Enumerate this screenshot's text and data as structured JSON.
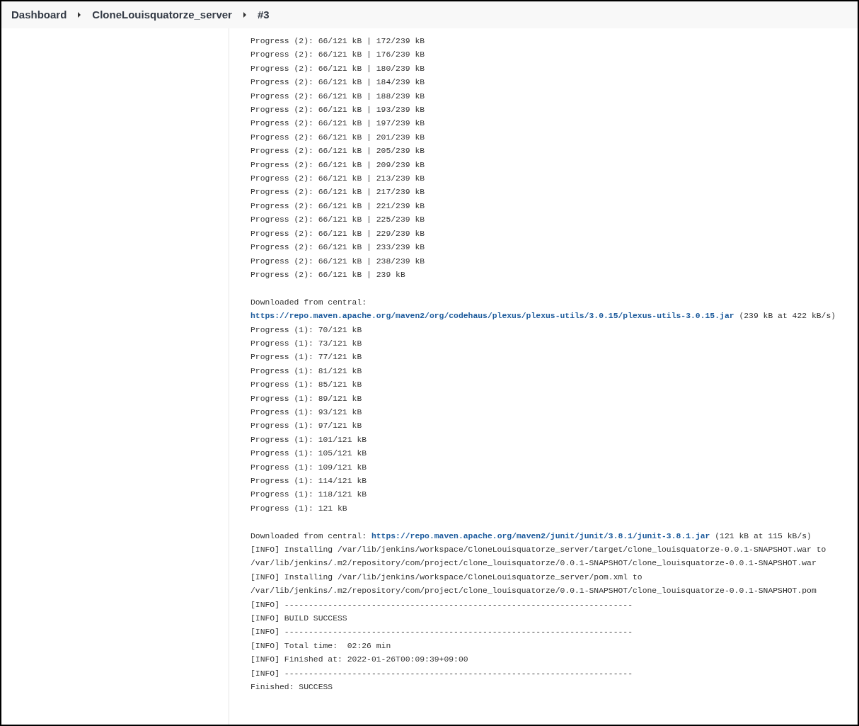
{
  "breadcrumbs": [
    {
      "label": "Dashboard"
    },
    {
      "label": "CloneLouisquatorze_server"
    },
    {
      "label": "#3"
    }
  ],
  "console": {
    "lines": [
      {
        "kind": "text",
        "text": "Progress (2): 66/121 kB | 172/239 kB"
      },
      {
        "kind": "text",
        "text": "Progress (2): 66/121 kB | 176/239 kB"
      },
      {
        "kind": "text",
        "text": "Progress (2): 66/121 kB | 180/239 kB"
      },
      {
        "kind": "text",
        "text": "Progress (2): 66/121 kB | 184/239 kB"
      },
      {
        "kind": "text",
        "text": "Progress (2): 66/121 kB | 188/239 kB"
      },
      {
        "kind": "text",
        "text": "Progress (2): 66/121 kB | 193/239 kB"
      },
      {
        "kind": "text",
        "text": "Progress (2): 66/121 kB | 197/239 kB"
      },
      {
        "kind": "text",
        "text": "Progress (2): 66/121 kB | 201/239 kB"
      },
      {
        "kind": "text",
        "text": "Progress (2): 66/121 kB | 205/239 kB"
      },
      {
        "kind": "text",
        "text": "Progress (2): 66/121 kB | 209/239 kB"
      },
      {
        "kind": "text",
        "text": "Progress (2): 66/121 kB | 213/239 kB"
      },
      {
        "kind": "text",
        "text": "Progress (2): 66/121 kB | 217/239 kB"
      },
      {
        "kind": "text",
        "text": "Progress (2): 66/121 kB | 221/239 kB"
      },
      {
        "kind": "text",
        "text": "Progress (2): 66/121 kB | 225/239 kB"
      },
      {
        "kind": "text",
        "text": "Progress (2): 66/121 kB | 229/239 kB"
      },
      {
        "kind": "text",
        "text": "Progress (2): 66/121 kB | 233/239 kB"
      },
      {
        "kind": "text",
        "text": "Progress (2): 66/121 kB | 238/239 kB"
      },
      {
        "kind": "text",
        "text": "Progress (2): 66/121 kB | 239 kB"
      },
      {
        "kind": "blank"
      },
      {
        "kind": "download",
        "prefix": "Downloaded from central:",
        "link": "https://repo.maven.apache.org/maven2/org/codehaus/plexus/plexus-utils/3.0.15/plexus-utils-3.0.15.jar",
        "suffix": "(239 kB at 422 kB/s)"
      },
      {
        "kind": "text",
        "text": "Progress (1): 70/121 kB"
      },
      {
        "kind": "text",
        "text": "Progress (1): 73/121 kB"
      },
      {
        "kind": "text",
        "text": "Progress (1): 77/121 kB"
      },
      {
        "kind": "text",
        "text": "Progress (1): 81/121 kB"
      },
      {
        "kind": "text",
        "text": "Progress (1): 85/121 kB"
      },
      {
        "kind": "text",
        "text": "Progress (1): 89/121 kB"
      },
      {
        "kind": "text",
        "text": "Progress (1): 93/121 kB"
      },
      {
        "kind": "text",
        "text": "Progress (1): 97/121 kB"
      },
      {
        "kind": "text",
        "text": "Progress (1): 101/121 kB"
      },
      {
        "kind": "text",
        "text": "Progress (1): 105/121 kB"
      },
      {
        "kind": "text",
        "text": "Progress (1): 109/121 kB"
      },
      {
        "kind": "text",
        "text": "Progress (1): 114/121 kB"
      },
      {
        "kind": "text",
        "text": "Progress (1): 118/121 kB"
      },
      {
        "kind": "text",
        "text": "Progress (1): 121 kB"
      },
      {
        "kind": "blank"
      },
      {
        "kind": "download",
        "prefix": "Downloaded from central:",
        "link": "https://repo.maven.apache.org/maven2/junit/junit/3.8.1/junit-3.8.1.jar",
        "suffix": "(121 kB at 115 kB/s)"
      },
      {
        "kind": "text",
        "text": "[INFO] Installing /var/lib/jenkins/workspace/CloneLouisquatorze_server/target/clone_louisquatorze-0.0.1-SNAPSHOT.war to /var/lib/jenkins/.m2/repository/com/project/clone_louisquatorze/0.0.1-SNAPSHOT/clone_louisquatorze-0.0.1-SNAPSHOT.war"
      },
      {
        "kind": "text",
        "text": "[INFO] Installing /var/lib/jenkins/workspace/CloneLouisquatorze_server/pom.xml to /var/lib/jenkins/.m2/repository/com/project/clone_louisquatorze/0.0.1-SNAPSHOT/clone_louisquatorze-0.0.1-SNAPSHOT.pom"
      },
      {
        "kind": "text",
        "text": "[INFO] ------------------------------------------------------------------------"
      },
      {
        "kind": "text",
        "text": "[INFO] BUILD SUCCESS"
      },
      {
        "kind": "text",
        "text": "[INFO] ------------------------------------------------------------------------"
      },
      {
        "kind": "text",
        "text": "[INFO] Total time:  02:26 min"
      },
      {
        "kind": "text",
        "text": "[INFO] Finished at: 2022-01-26T00:09:39+09:00"
      },
      {
        "kind": "text",
        "text": "[INFO] ------------------------------------------------------------------------"
      },
      {
        "kind": "text",
        "text": "Finished: SUCCESS"
      }
    ]
  }
}
